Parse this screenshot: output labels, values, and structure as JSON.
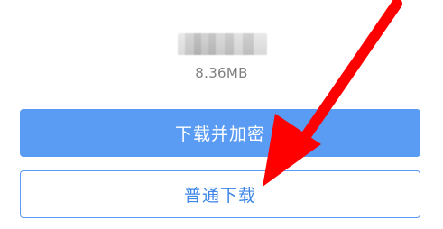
{
  "file": {
    "size": "8.36MB"
  },
  "buttons": {
    "encrypt_download": "下载并加密",
    "normal_download": "普通下载"
  },
  "colors": {
    "primary": "#5a9cf3",
    "annotation_arrow": "#ff0000"
  }
}
